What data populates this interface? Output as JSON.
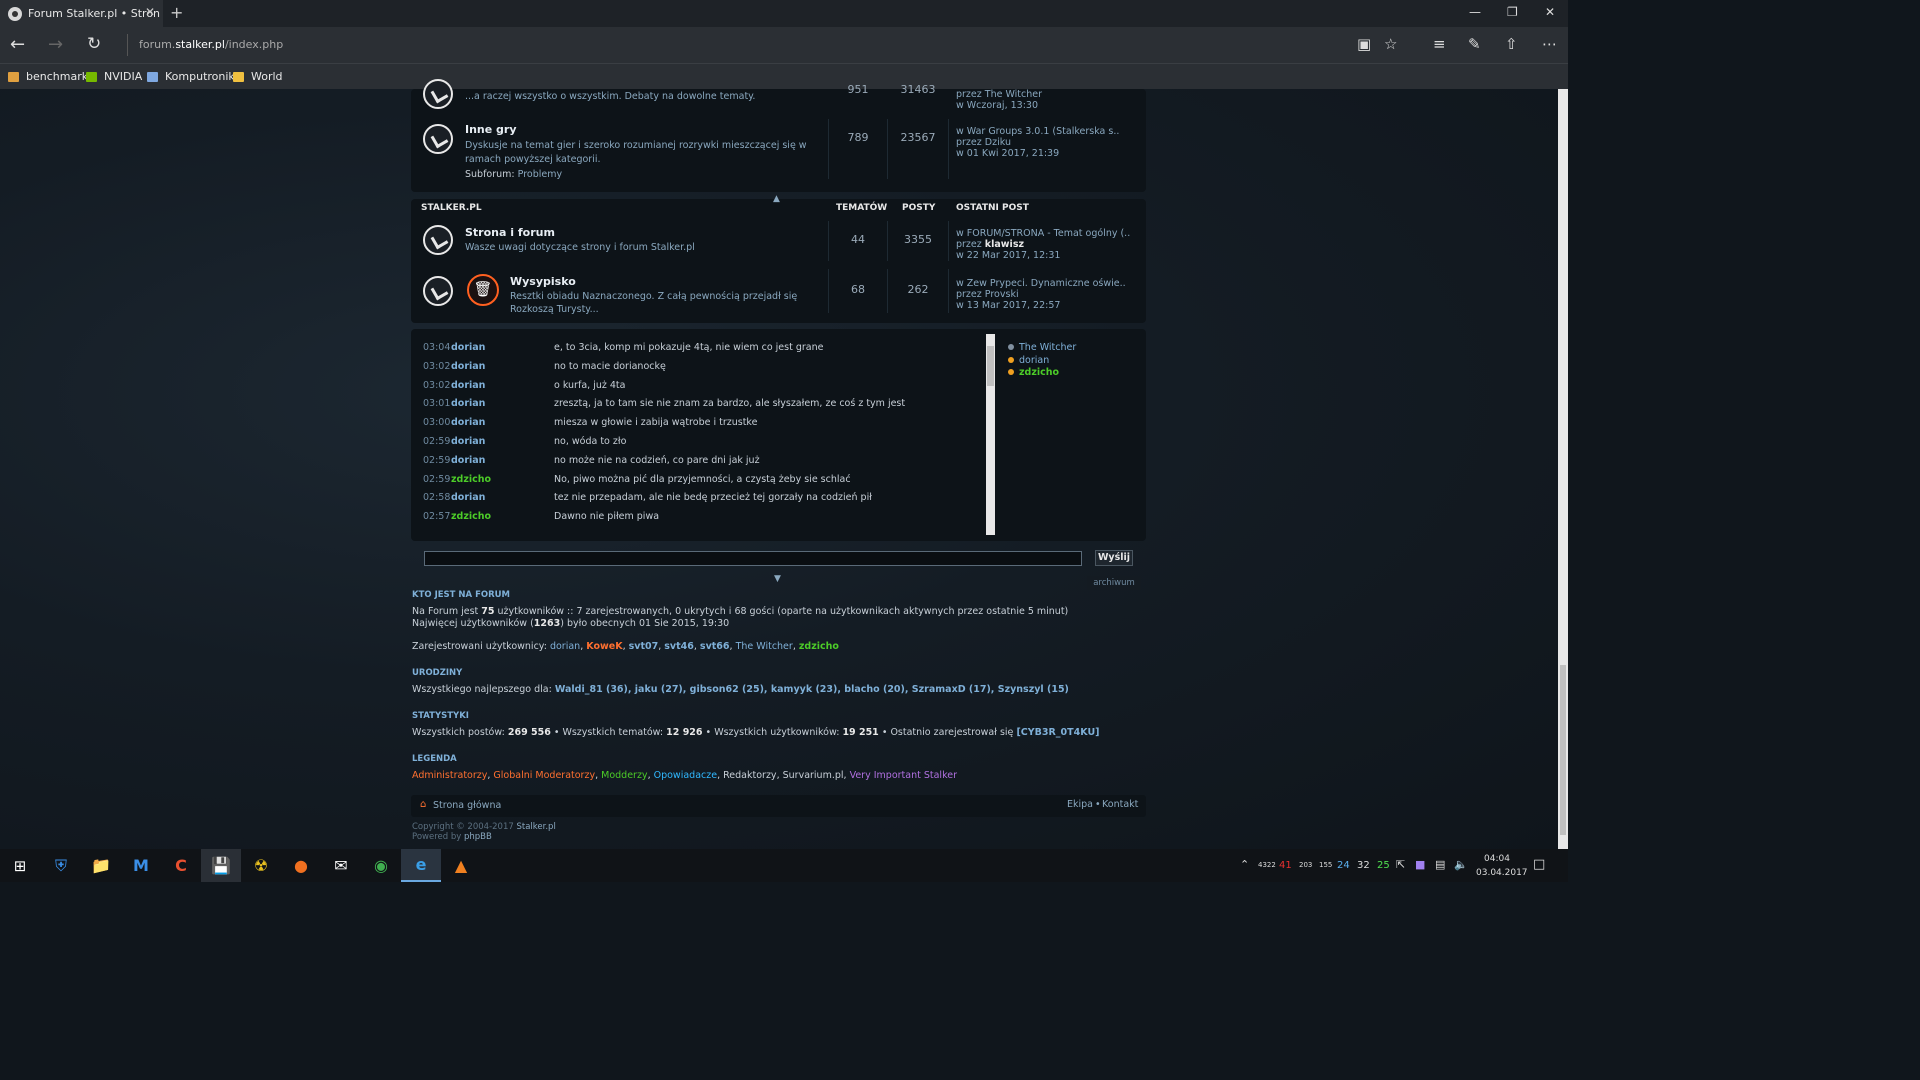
{
  "browser": {
    "tab_title": "Forum Stalker.pl • Stron",
    "tab_close": "✕",
    "new_tab": "+",
    "url_prefix": "forum.",
    "url_host": "stalker.pl",
    "url_path": "/index.php",
    "favorites": [
      {
        "label": "benchmark",
        "color": "#e0a040"
      },
      {
        "label": "NVIDIA",
        "color": "#76b900"
      },
      {
        "label": "Komputronik",
        "color": "#7fa8e0"
      },
      {
        "label": "World",
        "color": "#f0c040"
      }
    ]
  },
  "forums_top": [
    {
      "desc": "...a raczej wszystko o wszystkim. Debaty na dowolne tematy.",
      "topics": "951",
      "posts": "31463",
      "lp1": "przez The Witcher",
      "lp2": "w Wczoraj, 13:30"
    },
    {
      "title": "Inne gry",
      "desc1": "Dyskusje na temat gier i szeroko rozumianej rozrywki mieszczącej się w",
      "desc2": "ramach powyższej kategorii.",
      "subforum_label": "Subforum:",
      "subforum": "Problemy",
      "topics": "789",
      "posts": "23567",
      "lp1": "w War Groups 3.0.1 (Stalkerska s..",
      "lp2_pre": "przez",
      "lp2_user": "Dziku",
      "lp3": "w 01 Kwi 2017, 21:39"
    }
  ],
  "category": {
    "name": "STALKER.PL",
    "col_topics": "TEMATÓW",
    "col_posts": "POSTY",
    "col_last": "OSTATNI POST"
  },
  "forums_stalker": [
    {
      "title": "Strona i forum",
      "desc": "Wasze uwagi dotyczące strony i forum Stalker.pl",
      "topics": "44",
      "posts": "3355",
      "lp1": "w FORUM/STRONA - Temat ogólny (..",
      "lp2_pre": "przez",
      "lp2_user": "klawisz",
      "lp3": "w 22 Mar 2017, 12:31"
    },
    {
      "title": "Wysypisko",
      "desc1": "Resztki obiadu Naznaczonego. Z całą pewnością przejadł się",
      "desc2": "Rozkoszą Turysty...",
      "topics": "68",
      "posts": "262",
      "lp1": "w Zew Prypeci. Dynamiczne oświe..",
      "lp2_pre": "przez",
      "lp2_user": "Provski",
      "lp3": "w 13 Mar 2017, 22:57"
    }
  ],
  "shoutbox": {
    "messages": [
      {
        "time": "03:04",
        "user": "dorian",
        "color": "#7fb0d8",
        "msg": "e, to 3cia, komp mi pokazuje 4tą, nie wiem co jest grane"
      },
      {
        "time": "03:02",
        "user": "dorian",
        "color": "#7fb0d8",
        "msg": "no to macie dorianockę"
      },
      {
        "time": "03:02",
        "user": "dorian",
        "color": "#7fb0d8",
        "msg": "o kurfa, już 4ta"
      },
      {
        "time": "03:01",
        "user": "dorian",
        "color": "#7fb0d8",
        "msg": "zresztą, ja to tam sie nie znam za bardzo, ale słyszałem, ze coś z tym jest"
      },
      {
        "time": "03:00",
        "user": "dorian",
        "color": "#7fb0d8",
        "msg": "miesza w głowie i zabija wątrobe i trzustke"
      },
      {
        "time": "02:59",
        "user": "dorian",
        "color": "#7fb0d8",
        "msg": "no, wóda to zło"
      },
      {
        "time": "02:59",
        "user": "dorian",
        "color": "#7fb0d8",
        "msg": "no może nie na codzień, co pare dni jak już"
      },
      {
        "time": "02:59",
        "user": "zdzicho",
        "color": "#4ccc28",
        "msg": "No, piwo można pić dla przyjemności, a czystą żeby sie schlać"
      },
      {
        "time": "02:58",
        "user": "dorian",
        "color": "#7fb0d8",
        "msg": "tez nie przepadam, ale nie bedę przecież tej gorzały na codzień pił"
      },
      {
        "time": "02:57",
        "user": "zdzicho",
        "color": "#4ccc28",
        "msg": "Dawno nie piłem piwa"
      }
    ],
    "online": [
      {
        "name": "The Witcher",
        "color": "#7fb0d8",
        "dot": "#8090a0"
      },
      {
        "name": "dorian",
        "color": "#7fb0d8",
        "dot": "#f0a020"
      },
      {
        "name": "zdzicho",
        "color": "#4ccc28",
        "dot": "#f0a020"
      }
    ],
    "send_label": "Wyślij",
    "archive_label": "archiwum"
  },
  "whois": {
    "heading": "KTO JEST NA FORUM",
    "l1_a": "Na Forum jest ",
    "l1_n": "75",
    "l1_b": " użytkowników :: 7 zarejestrowanych, 0 ukrytych i 68 gości (oparte na użytkownikach aktywnych przez ostatnie 5 minut)",
    "l2_a": "Najwięcej użytkowników (",
    "l2_n": "1263",
    "l2_b": ") było obecnych 01 Sie 2015, 19:30",
    "reg_label": "Zarejestrowani użytkownicy:",
    "users": [
      {
        "n": "dorian",
        "c": "#7fb0d8",
        "b": false
      },
      {
        "n": "KoweK",
        "c": "#ff7030",
        "b": true
      },
      {
        "n": "svt07",
        "c": "#7fb0d8",
        "b": true
      },
      {
        "n": "svt46",
        "c": "#7fb0d8",
        "b": true
      },
      {
        "n": "svt66",
        "c": "#7fb0d8",
        "b": true
      },
      {
        "n": "The Witcher",
        "c": "#7fb0d8",
        "b": false
      },
      {
        "n": "zdzicho",
        "c": "#4ccc28",
        "b": true
      }
    ]
  },
  "birthdays": {
    "heading": "URODZINY",
    "label": "Wszystkiego najlepszego dla:",
    "list": "Waldi_81 (36), jaku (27), gibson62 (25), kamyyk (23), blacho (20), SzramaxD (17), Szynszyl (15)"
  },
  "stats": {
    "heading": "STATYSTYKI",
    "p_label": "Wszystkich postów:",
    "p": "269 556",
    "t_label": "Wszystkich tematów:",
    "t": "12 926",
    "u_label": "Wszystkich użytkowników:",
    "u": "19 251",
    "last_label": "Ostatnio zarejestrował się",
    "last": "[CYB3R_0T4KU]"
  },
  "legend": {
    "heading": "LEGENDA",
    "items": [
      {
        "n": "Administratorzy",
        "c": "#ff7030"
      },
      {
        "n": "Globalni Moderatorzy",
        "c": "#ff7030"
      },
      {
        "n": "Modderzy",
        "c": "#4ccc28"
      },
      {
        "n": "Opowiadacze",
        "c": "#30b8ff"
      },
      {
        "n": "Redaktorzy",
        "c": "#c8d0d8"
      },
      {
        "n": "Survarium.pl",
        "c": "#c8d0d8"
      },
      {
        "n": "Very Important Stalker",
        "c": "#b070e0"
      }
    ]
  },
  "footer": {
    "home": "Strona główna",
    "team": "Ekipa",
    "contact": "Kontakt",
    "copyright": "Copyright © 2004-2017",
    "copy_site": "Stalker.pl",
    "powered": "Powered by",
    "phpbb": "phpBB"
  },
  "taskbar": {
    "time": "04:04",
    "date": "03.04.2017",
    "tray_nums": [
      "4322",
      "41",
      "203",
      "155",
      "24",
      "32",
      "25"
    ]
  }
}
